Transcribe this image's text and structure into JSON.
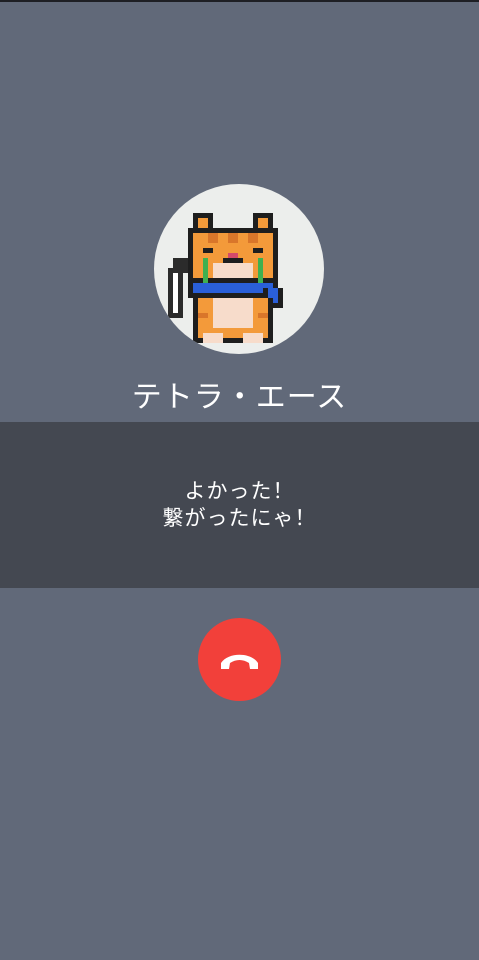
{
  "caller": {
    "name": "テトラ・エース",
    "avatar_icon": "pixel-cat-avatar"
  },
  "message": {
    "line1": "よかった！",
    "line2": "繋がったにゃ！"
  },
  "controls": {
    "end_call_icon": "phone-hangup-icon",
    "end_call_color": "#f2403a"
  },
  "colors": {
    "background": "#616979",
    "panel": "#444851",
    "avatar_bg": "#eceeec"
  }
}
